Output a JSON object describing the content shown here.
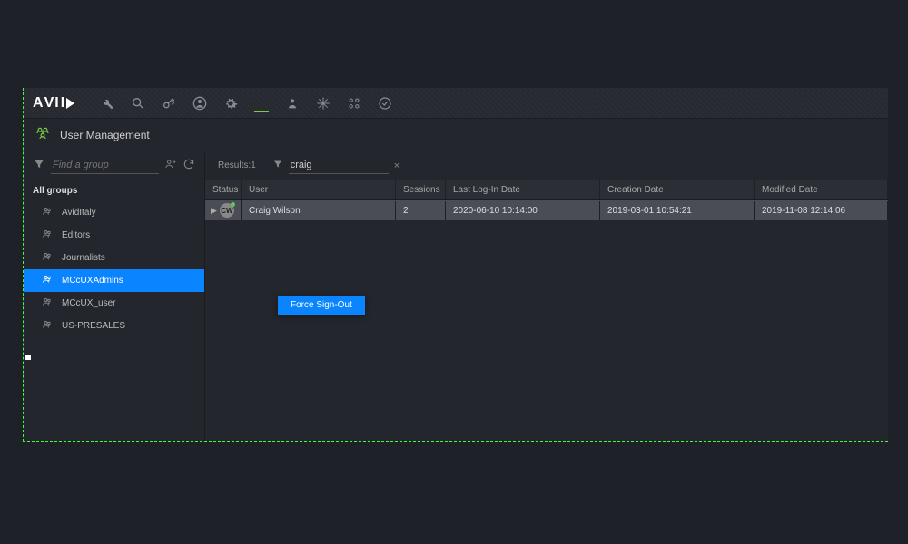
{
  "header": {
    "title": "User Management"
  },
  "sidebar": {
    "search_placeholder": "Find a group",
    "all_groups_label": "All groups",
    "items": [
      {
        "label": "AvidItaly",
        "selected": false
      },
      {
        "label": "Editors",
        "selected": false
      },
      {
        "label": "Journalists",
        "selected": false
      },
      {
        "label": "MCcUXAdmins",
        "selected": true
      },
      {
        "label": "MCcUX_user",
        "selected": false
      },
      {
        "label": "US-PRESALES",
        "selected": false
      }
    ]
  },
  "main": {
    "results_label": "Results:1",
    "filter_value": "craig",
    "columns": {
      "status": "Status",
      "user": "User",
      "sessions": "Sessions",
      "last_login": "Last Log-In Date",
      "creation": "Creation Date",
      "modified": "Modified Date"
    },
    "rows": [
      {
        "avatar_initials": "CW",
        "user": "Craig Wilson",
        "sessions": "2",
        "last_login": "2020-06-10 10:14:00",
        "creation": "2019-03-01 10:54:21",
        "modified": "2019-11-08 12:14:06"
      }
    ],
    "context_menu": {
      "force_signout": "Force Sign-Out"
    }
  }
}
